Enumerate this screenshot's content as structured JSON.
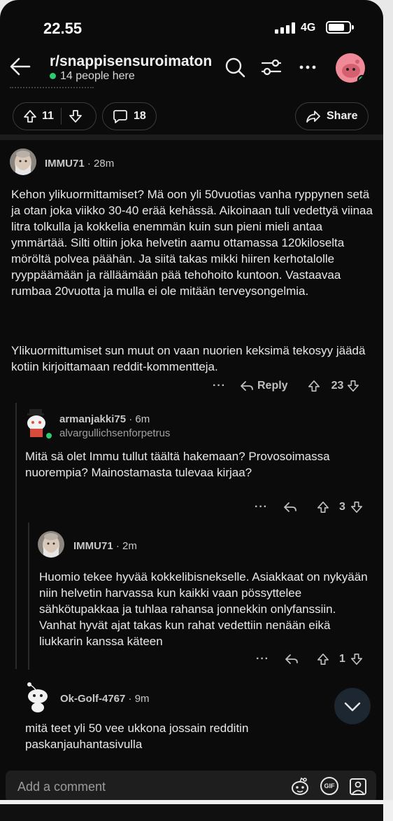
{
  "status_bar": {
    "time": "22.55",
    "network": "4G"
  },
  "header": {
    "subreddit": "r/snappisensuroimaton",
    "online_text": "14 people here"
  },
  "post_actions": {
    "upvotes": "11",
    "comments": "18",
    "share_label": "Share"
  },
  "comments": [
    {
      "author": "IMMU71",
      "time": "28m",
      "paragraphs": [
        "Kehon ylikuormittamiset? Mä oon yli 50vuotias vanha ryppynen setä ja otan joka viikko 30-40 erää kehässä. Aikoinaan tuli vedettyä viinaa litra tolkulla ja kokkelia enemmän kuin sun pieni mieli antaa ymmärtää. Silti oltiin joka helvetin aamu ottamassa 120kiloselta möröltä polvea päähän. Ja siitä takas mikki hiiren kerhotalolle ryyppäämään ja rälläämään pää tehohoito kuntoon. Vastaavaa rumbaa 20vuotta ja mulla ei ole mitään terveysongelmia.",
        "Ylikuormittumiset sun muut on vaan nuorien keksimä tekosyy jäädä kotiin kirjoittamaan reddit-kommentteja."
      ],
      "reply_label": "Reply",
      "votes": "23"
    },
    {
      "author": "armanjakki75",
      "time": "6m",
      "flair": "alvargullichsenforpetrus",
      "paragraphs": [
        "Mitä sä olet Immu tullut täältä hakemaan? Provosoimassa nuorempia? Mainostamasta tulevaa kirjaa?"
      ],
      "votes": "3"
    },
    {
      "author": "IMMU71",
      "time": "2m",
      "paragraphs": [
        "Huomio tekee hyvää kokkelibisnekselle. Asiakkaat on nykyään niin helvetin harvassa kun kaikki vaan pössyttelee sähkötupakkaa ja tuhlaa rahansa jonnekkin onlyfanssiin. Vanhat hyvät ajat takas kun rahat vedettiin nenään eikä liukkarin kanssa käteen"
      ],
      "votes": "1"
    },
    {
      "author": "Ok-Golf-4767",
      "time": "9m",
      "paragraphs": [
        "mitä teet yli 50 vee ukkona jossain redditin paskanjauhantasivulla"
      ]
    }
  ],
  "comment_bar": {
    "placeholder": "Add a comment",
    "gif_label": "GIF"
  },
  "colors": {
    "online_green": "#2ecc71",
    "background": "#0b0b0b",
    "avatar_pink": "#f08a98"
  }
}
